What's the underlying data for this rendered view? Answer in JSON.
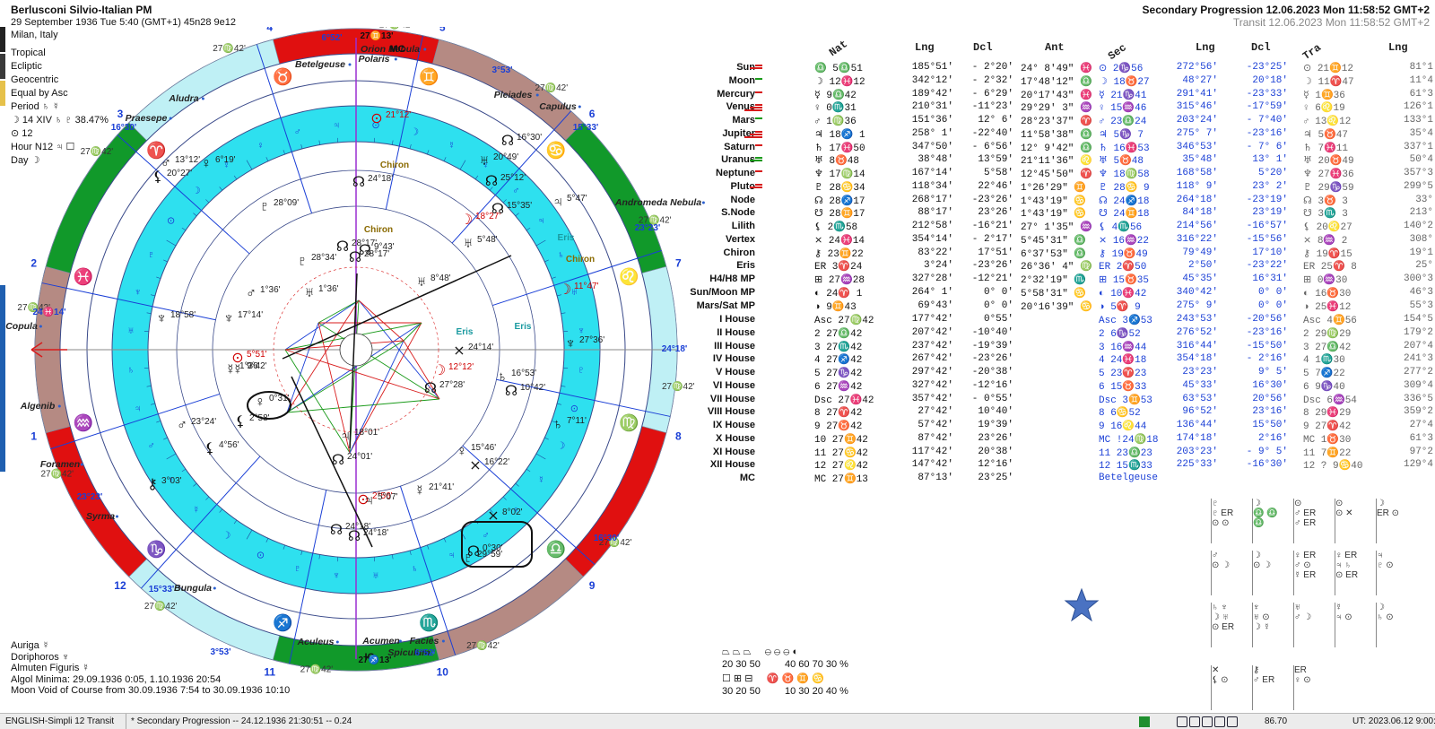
{
  "header_left": {
    "name": "Berlusconi Silvio-Italian PM",
    "date_line": "29 September 1936  Tue   5:40 (GMT+1) 45n28  9e12",
    "place": "Milan, Italy"
  },
  "info": {
    "lines": [
      "Tropical",
      "Ecliptic",
      "Geocentric",
      "Equal by Asc",
      "Period ♄ ☿",
      "☽  14 XIV ♄ ♇ 38.47%",
      "⊙  12",
      "Hour N12 ♃ ☐",
      "Day ☽"
    ]
  },
  "header_right": {
    "line1": "Secondary Progression 12.06.2023  Mon 11:58:52 GMT+2",
    "line2": "Transit 12.06.2023  Mon 11:58:52 GMT+2"
  },
  "columns": {
    "nat": "Nat",
    "lng": "Lng",
    "dcl": "Dcl",
    "ant": "Ant",
    "sec": "Sec",
    "lng2": "Lng",
    "dcl2": "Dcl",
    "tra": "Tra",
    "lng3": "Lng"
  },
  "planets": [
    {
      "name": "Sun",
      "nat": "♎  5♎51",
      "lng": "185°51'",
      "dcl": "- 2°20'",
      "ant": "24° 8'49\" ♓",
      "sec": "⊙  2♑56",
      "lng2": "272°56'",
      "dcl2": "-23°25'",
      "tra": "⊙ 21♊12",
      "lng3": "81°1"
    },
    {
      "name": "Moon",
      "nat": "☽ 12♓12",
      "lng": "342°12'",
      "dcl": "- 2°32'",
      "ant": "17°48'12\" ♎",
      "sec": "☽ 18♉27",
      "lng2": "48°27'",
      "dcl2": "20°18'",
      "tra": "☽ 11♈47",
      "lng3": "11°4"
    },
    {
      "name": "Mercury",
      "nat": "☿  9♎42",
      "lng": "189°42'",
      "dcl": "- 6°29'",
      "ant": "20°17'43\" ♓",
      "sec": "☿ 21♑41",
      "lng2": "291°41'",
      "dcl2": "-23°33'",
      "tra": "☿  1♊36",
      "lng3": "61°3"
    },
    {
      "name": "Venus",
      "nat": "♀  0♏31",
      "lng": "210°31'",
      "dcl": "-11°23'",
      "ant": "29°29' 3\" ♒",
      "sec": "♀ 15♒46",
      "lng2": "315°46'",
      "dcl2": "-17°59'",
      "tra": "♀  6♌19",
      "lng3": "126°1"
    },
    {
      "name": "Mars",
      "nat": "♂  1♍36",
      "lng": "151°36'",
      "dcl": "12° 6'",
      "ant": "28°23'37\" ♈",
      "sec": "♂ 23♎24",
      "lng2": "203°24'",
      "dcl2": "- 7°40'",
      "tra": "♂ 13♌12",
      "lng3": "133°1"
    },
    {
      "name": "Jupiter",
      "nat": "♃ 18♐ 1",
      "lng": "258° 1'",
      "dcl": "-22°40'",
      "ant": "11°58'38\" ♎",
      "sec": "♃  5♑ 7",
      "lng2": "275° 7'",
      "dcl2": "-23°16'",
      "tra": "♃  5♉47",
      "lng3": "35°4"
    },
    {
      "name": "Saturn",
      "nat": "♄ 17♓50",
      "lng": "347°50'",
      "dcl": "- 6°56'",
      "ant": "12° 9'42\" ♎",
      "sec": "♄ 16♓53",
      "lng2": "346°53'",
      "dcl2": "- 7° 6'",
      "tra": "♄  7♓11",
      "lng3": "337°1"
    },
    {
      "name": "Uranus",
      "nat": "♅  8♉48",
      "lng": "38°48'",
      "dcl": "13°59'",
      "ant": "21°11'36\" ♌",
      "sec": "♅  5♉48",
      "lng2": "35°48'",
      "dcl2": "13° 1'",
      "tra": "♅ 20♉49",
      "lng3": "50°4"
    },
    {
      "name": "Neptune",
      "nat": "♆ 17♍14",
      "lng": "167°14'",
      "dcl": "5°58'",
      "ant": "12°45'50\" ♈",
      "sec": "♆ 18♍58",
      "lng2": "168°58'",
      "dcl2": "5°20'",
      "tra": "♆ 27♓36",
      "lng3": "357°3"
    },
    {
      "name": "Pluto",
      "nat": "♇ 28♋34",
      "lng": "118°34'",
      "dcl": "22°46'",
      "ant": "1°26'29\" ♊",
      "sec": "♇ 28♋ 9",
      "lng2": "118° 9'",
      "dcl2": "23° 2'",
      "tra": "♇ 29♑59",
      "lng3": "299°5"
    },
    {
      "name": "Node",
      "nat": "☊ 28♐17",
      "lng": "268°17'",
      "dcl": "-23°26'",
      "ant": "1°43'19\" ♋",
      "sec": "☊ 24♐18",
      "lng2": "264°18'",
      "dcl2": "-23°19'",
      "tra": "☊  3♉ 3",
      "lng3": "33°"
    },
    {
      "name": "S.Node",
      "nat": "☋ 28♊17",
      "lng": "88°17'",
      "dcl": "23°26'",
      "ant": "1°43'19\" ♋",
      "sec": "☋ 24♊18",
      "lng2": "84°18'",
      "dcl2": "23°19'",
      "tra": "☋  3♏ 3",
      "lng3": "213°"
    },
    {
      "name": "Lilith",
      "nat": "⚸  2♏58",
      "lng": "212°58'",
      "dcl": "-16°21'",
      "ant": "27° 1'35\" ♒",
      "sec": "⚸  4♏56",
      "lng2": "214°56'",
      "dcl2": "-16°57'",
      "tra": "⚸ 20♌27",
      "lng3": "140°2"
    },
    {
      "name": "Vertex",
      "nat": "⨯ 24♓14",
      "lng": "354°14'",
      "dcl": "- 2°17'",
      "ant": "5°45'31\" ♎",
      "sec": "⨯ 16♒22",
      "lng2": "316°22'",
      "dcl2": "-15°56'",
      "tra": "⨯  8♒ 2",
      "lng3": "308°"
    },
    {
      "name": "Chiron",
      "nat": "⚷ 23♊22",
      "lng": "83°22'",
      "dcl": "17°51'",
      "ant": "6°37'53\" ♎",
      "sec": "⚷ 19♉49",
      "lng2": "79°49'",
      "dcl2": "17°10'",
      "tra": "⚷ 19♈15",
      "lng3": "19°1"
    },
    {
      "name": "Eris",
      "nat": "ER  3♈24",
      "lng": "3°24'",
      "dcl": "-23°26'",
      "ant": "26°36' 4\" ♍",
      "sec": "ER  2♈50",
      "lng2": "2°50'",
      "dcl2": "-23°22'",
      "tra": "ER 25♈ 8",
      "lng3": "25°"
    },
    {
      "name": "H4/H8 MP",
      "nat": "⊞ 27♒28",
      "lng": "327°28'",
      "dcl": "-12°21'",
      "ant": "2°32'19\" ♏",
      "sec": "⊞ 15♉35",
      "lng2": "45°35'",
      "dcl2": "16°31'",
      "tra": "⊞  0♒30",
      "lng3": "300°3"
    },
    {
      "name": "Sun/Moon MP",
      "nat": "◐ 24♈ 1",
      "lng": "264° 1'",
      "dcl": "0° 0'",
      "ant": "5°58'31\" ♋",
      "sec": "◐ 10♓42",
      "lng2": "340°42'",
      "dcl2": "0° 0'",
      "tra": "◐ 16♉30",
      "lng3": "46°3"
    },
    {
      "name": "Mars/Sat MP",
      "nat": "◑  9♊43",
      "lng": "69°43'",
      "dcl": "0° 0'",
      "ant": "20°16'39\" ♋",
      "sec": "◑  5♈ 9",
      "lng2": "275° 9'",
      "dcl2": "0° 0'",
      "tra": "◑ 25♓12",
      "lng3": "55°3"
    }
  ],
  "houses": [
    {
      "name": "I House",
      "nat": "Asc 27♍42",
      "lng": "177°42'",
      "dcl": "0°55'",
      "sec": "Asc  3♐53",
      "lng2": "243°53'",
      "dcl2": "-20°56'",
      "tra": "Asc  4♊56",
      "lng3": "154°5"
    },
    {
      "name": "II House",
      "nat": "2 27♎42",
      "lng": "207°42'",
      "dcl": "-10°40'",
      "sec": "2  6♑52",
      "lng2": "276°52'",
      "dcl2": "-23°16'",
      "tra": "2 29♍29",
      "lng3": "179°2"
    },
    {
      "name": "III House",
      "nat": "3 27♏42",
      "lng": "237°42'",
      "dcl": "-19°39'",
      "sec": "3 16♒44",
      "lng2": "316°44'",
      "dcl2": "-15°50'",
      "tra": "3 27♎42",
      "lng3": "207°4"
    },
    {
      "name": "IV House",
      "nat": "4 27♐42",
      "lng": "267°42'",
      "dcl": "-23°26'",
      "sec": "4 24♓18",
      "lng2": "354°18'",
      "dcl2": "- 2°16'",
      "tra": "4  1♏30",
      "lng3": "241°3"
    },
    {
      "name": "V House",
      "nat": "5 27♑42",
      "lng": "297°42'",
      "dcl": "-20°38'",
      "sec": "5 23♈23",
      "lng2": "23°23'",
      "dcl2": "9° 5'",
      "tra": "5  7♐22",
      "lng3": "277°2"
    },
    {
      "name": "VI House",
      "nat": "6 27♒42",
      "lng": "327°42'",
      "dcl": "-12°16'",
      "sec": "6 15♉33",
      "lng2": "45°33'",
      "dcl2": "16°30'",
      "tra": "6  9♑40",
      "lng3": "309°4"
    },
    {
      "name": "VII House",
      "nat": "Dsc 27♓42",
      "lng": "357°42'",
      "dcl": "- 0°55'",
      "sec": "Dsc  3♊53",
      "lng2": "63°53'",
      "dcl2": "20°56'",
      "tra": "Dsc  6♒54",
      "lng3": "336°5"
    },
    {
      "name": "VIII House",
      "nat": "8 27♈42",
      "lng": "27°42'",
      "dcl": "10°40'",
      "sec": "8  6♋52",
      "lng2": "96°52'",
      "dcl2": "23°16'",
      "tra": "8 29♓29",
      "lng3": "359°2"
    },
    {
      "name": "IX House",
      "nat": "9 27♉42",
      "lng": "57°42'",
      "dcl": "19°39'",
      "sec": "9 16♌44",
      "lng2": "136°44'",
      "dcl2": "15°50'",
      "tra": "9 27♈42",
      "lng3": "27°4"
    },
    {
      "name": "X House",
      "nat": "10 27♊42",
      "lng": "87°42'",
      "dcl": "23°26'",
      "sec": "MC !24♍18",
      "lng2": "174°18'",
      "dcl2": "2°16'",
      "tra": "MC  1♉30",
      "lng3": "61°3"
    },
    {
      "name": "XI House",
      "nat": "11 27♋42",
      "lng": "117°42'",
      "dcl": "20°38'",
      "sec": "11 23♎23",
      "lng2": "203°23'",
      "dcl2": "- 9° 5'",
      "tra": "11  7♊22",
      "lng3": "97°2"
    },
    {
      "name": "XII House",
      "nat": "12 27♌42",
      "lng": "147°42'",
      "dcl": "12°16'",
      "sec": "12 15♏33",
      "lng2": "225°33'",
      "dcl2": "-16°30'",
      "tra": "12 ? 9♋40",
      "lng3": "129°4"
    },
    {
      "name": "MC",
      "nat": "MC 27♊13",
      "lng": "87°13'",
      "dcl": "23°25'",
      "sec": "Betelgeuse",
      "lng2": "",
      "dcl2": "",
      "tra": "",
      "lng3": ""
    }
  ],
  "chart": {
    "zodiac_signs": [
      "♈",
      "♉",
      "♊",
      "♋",
      "♌",
      "♍",
      "♎",
      "♏",
      "♐",
      "♑",
      "♒",
      "♓"
    ],
    "house_numbers": [
      "1",
      "2",
      "3",
      "4",
      "5",
      "6",
      "7",
      "8",
      "9",
      "10",
      "11",
      "12"
    ],
    "cusp_label": "27♍42'",
    "stars": [
      "Polaris",
      "Orion Nebula",
      "Betelgeuse",
      "Pleiades",
      "Capulus",
      "Aludra",
      "Praesepe",
      "Andromeda Nebula",
      "Copula",
      "Algenib",
      "Foramen",
      "Syrma",
      "Bungula",
      "Aculeus",
      "Acumen",
      "Facies",
      "Spiculum"
    ],
    "labels": {
      "mc": "MC",
      "ic": "IC",
      "asc_deg": "24♓14'",
      "mc_top": "27♊13'",
      "deg_6_52": "6°52'",
      "deg_3_53": "3°53'",
      "deg_15_33": "15°33'",
      "deg_16_30": "16°30'",
      "deg_23_23": "23°23'",
      "deg_24_18": "24°18'",
      "ic_bottom": "27♐13'",
      "chiron": "Chiron",
      "eris": "Eris"
    },
    "planet_glyphs": [
      {
        "glyph": "⊙",
        "deg": "21°12'",
        "color": "#d00000"
      },
      {
        "glyph": "♆",
        "deg": "18°58'",
        "color": "#111"
      },
      {
        "glyph": "♆",
        "deg": "17°14'",
        "color": "#111"
      },
      {
        "glyph": "♇",
        "deg": "28°09'",
        "color": "#111"
      },
      {
        "glyph": "☽",
        "deg": "18°27'",
        "color": "#d00000"
      },
      {
        "glyph": "☽",
        "deg": "11°47'",
        "color": "#d00000"
      },
      {
        "glyph": "☽",
        "deg": "12°12'",
        "color": "#d00000"
      },
      {
        "glyph": "⊙",
        "deg": "5°51'",
        "color": "#d00000"
      },
      {
        "glyph": "⊙",
        "deg": "2°56'",
        "color": "#d00000"
      },
      {
        "glyph": "♂",
        "deg": "13°12'",
        "color": "#111"
      },
      {
        "glyph": "♂",
        "deg": "1°36'",
        "color": "#111"
      },
      {
        "glyph": "♂",
        "deg": "23°24'",
        "color": "#111"
      },
      {
        "glyph": "♀",
        "deg": "0°31'",
        "color": "#111"
      },
      {
        "glyph": "♀",
        "deg": "6°19'",
        "color": "#111"
      },
      {
        "glyph": "♀",
        "deg": "15°46'",
        "color": "#111"
      },
      {
        "glyph": "♄",
        "deg": "16°53'",
        "color": "#111"
      },
      {
        "glyph": "♄",
        "deg": "7°11'",
        "color": "#111"
      },
      {
        "glyph": "♅",
        "deg": "20°49'",
        "color": "#111"
      },
      {
        "glyph": "♅",
        "deg": "5°48'",
        "color": "#111"
      },
      {
        "glyph": "♅",
        "deg": "8°48'",
        "color": "#111"
      },
      {
        "glyph": "♃",
        "deg": "5°47'",
        "color": "#111"
      },
      {
        "glyph": "♃",
        "deg": "18°01'",
        "color": "#111"
      },
      {
        "glyph": "♃",
        "deg": "5°07'",
        "color": "#111"
      },
      {
        "glyph": "☊",
        "deg": "24°18'",
        "color": "#111"
      },
      {
        "glyph": "☊",
        "deg": "28°17'",
        "color": "#111"
      },
      {
        "glyph": "☊",
        "deg": "24°18'",
        "color": "#111"
      },
      {
        "glyph": "♇",
        "deg": "28°34'",
        "color": "#111"
      },
      {
        "glyph": "♇",
        "deg": "29°59'",
        "color": "#111"
      },
      {
        "glyph": "☿",
        "deg": "9°42'",
        "color": "#111"
      },
      {
        "glyph": "☿",
        "deg": "1°36'",
        "color": "#111"
      },
      {
        "glyph": "☿",
        "deg": "21°41'",
        "color": "#111"
      },
      {
        "glyph": "⚸",
        "deg": "2°58'",
        "color": "#111"
      },
      {
        "glyph": "⚸",
        "deg": "4°56'",
        "color": "#111"
      },
      {
        "glyph": "⚸",
        "deg": "20°27'",
        "color": "#111"
      },
      {
        "glyph": "♆",
        "deg": "27°36'",
        "color": "#111"
      },
      {
        "glyph": "⚷",
        "deg": "3°03'",
        "color": "#111"
      },
      {
        "glyph": "⨯",
        "deg": "24°14'",
        "color": "#111"
      },
      {
        "glyph": "⨯",
        "deg": "16°22'",
        "color": "#111"
      },
      {
        "glyph": "⨯",
        "deg": "8°02'",
        "color": "#111"
      },
      {
        "glyph": "☊",
        "deg": "24°01'",
        "color": "#111"
      },
      {
        "glyph": "☊",
        "deg": "27°28'",
        "color": "#111"
      },
      {
        "glyph": "☊",
        "deg": "10°42'",
        "color": "#111"
      },
      {
        "glyph": "☊",
        "deg": "25°12'",
        "color": "#111"
      },
      {
        "glyph": "♅",
        "deg": "1°36'",
        "color": "#111"
      },
      {
        "glyph": "☊",
        "deg": "16°30'",
        "color": "#111"
      },
      {
        "glyph": "☊",
        "deg": "0°30'",
        "color": "#111"
      },
      {
        "glyph": "☊",
        "deg": "9°43'",
        "color": "#111"
      },
      {
        "glyph": "☊",
        "deg": "28°17'",
        "color": "#111"
      },
      {
        "glyph": "☊",
        "deg": "24°18'",
        "color": "#111"
      },
      {
        "glyph": "☊",
        "deg": "15°35'",
        "color": "#111"
      }
    ]
  },
  "bottom_left": {
    "lines": [
      "Auriga ☿",
      "Doriphoros ♆",
      "Almuten Figuris ☿",
      "Algol Minima: 29.09.1936  0:05,  1.10.1936 20:54",
      "Moon Void of Course from 30.09.1936  7:54 to 30.09.1936 10:10"
    ]
  },
  "elements": {
    "row1": "20  30  50",
    "row2": "40  60  70  30 %",
    "row3": "30  20  50",
    "row4": "10  30  20  40 %"
  },
  "status_bar": {
    "lang": "ENGLISH-Simpli 12 Transit",
    "prog": "* Secondary Progression -- 24.12.1936 21:30:51 -- 0.24",
    "zoom": "86.70",
    "ut": "UT: 2023.06.12  9:00:1"
  }
}
